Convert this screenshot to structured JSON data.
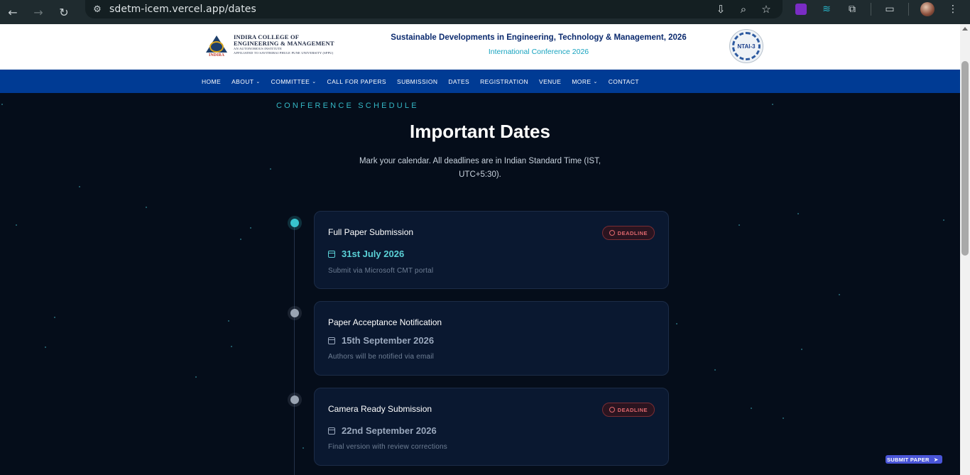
{
  "browser": {
    "url": "sdetm-icem.vercel.app/dates"
  },
  "header": {
    "college_line1": "INDIRA COLLEGE OF",
    "college_line2": "ENGINEERING & MANAGEMENT",
    "college_line3": "AN AUTONOMOUS INSTITUTE",
    "college_line4": "AFFILIATED TO SAVITRIBAI PHULE PUNE UNIVERSITY (SPPU)",
    "logo_caption": "INDIRA",
    "conference_title": "Sustainable Developments in Engineering, Technology & Management, 2026",
    "conference_subtitle": "International Conference 2026",
    "badge_text": "NTAI-3"
  },
  "nav": {
    "items": [
      {
        "label": "HOME",
        "dropdown": false
      },
      {
        "label": "ABOUT",
        "dropdown": true
      },
      {
        "label": "COMMITTEE",
        "dropdown": true
      },
      {
        "label": "CALL FOR PAPERS",
        "dropdown": false
      },
      {
        "label": "SUBMISSION",
        "dropdown": false
      },
      {
        "label": "DATES",
        "dropdown": false
      },
      {
        "label": "REGISTRATION",
        "dropdown": false
      },
      {
        "label": "VENUE",
        "dropdown": false
      },
      {
        "label": "MORE",
        "dropdown": true
      },
      {
        "label": "CONTACT",
        "dropdown": false
      }
    ]
  },
  "hero": {
    "eyebrow": "CONFERENCE SCHEDULE",
    "title": "Important Dates",
    "description": "Mark your calendar. All deadlines are in Indian Standard Time (IST, UTC+5:30)."
  },
  "timeline": [
    {
      "title": "Full Paper Submission",
      "date": "31st July 2026",
      "note": "Submit via Microsoft CMT portal",
      "badge": "DEADLINE",
      "active": true
    },
    {
      "title": "Paper Acceptance Notification",
      "date": "15th September 2026",
      "note": "Authors will be notified via email",
      "badge": "",
      "active": false
    },
    {
      "title": "Camera Ready Submission",
      "date": "22nd September 2026",
      "note": "Final version with review corrections",
      "badge": "DEADLINE",
      "active": false
    }
  ],
  "fab": {
    "label": "SUBMIT PAPER"
  },
  "colors": {
    "page_bg": "#050d1a",
    "navbar_bg": "#003b94",
    "accent_teal": "#38c5cf",
    "deadline_red": "#e0686e"
  }
}
